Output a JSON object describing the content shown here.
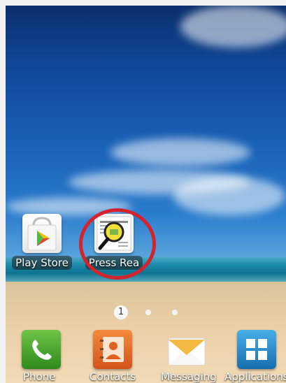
{
  "home_screen": {
    "apps": [
      {
        "label": "Play Store",
        "icon": "play-store-icon"
      },
      {
        "label": "Press Rea",
        "icon": "press-reader-icon"
      }
    ],
    "page_indicator": {
      "current_page": "1",
      "total_pages": 3
    },
    "highlight_color": "#d3232c"
  },
  "dock": [
    {
      "label": "Phone",
      "icon": "phone-icon",
      "color": "#3c9a21"
    },
    {
      "label": "Contacts",
      "icon": "contacts-icon",
      "color": "#e2611f"
    },
    {
      "label": "Messaging",
      "icon": "messaging-icon",
      "color": "#f0b43a"
    },
    {
      "label": "Applications",
      "icon": "applications-icon",
      "color": "#1f86c4"
    }
  ]
}
